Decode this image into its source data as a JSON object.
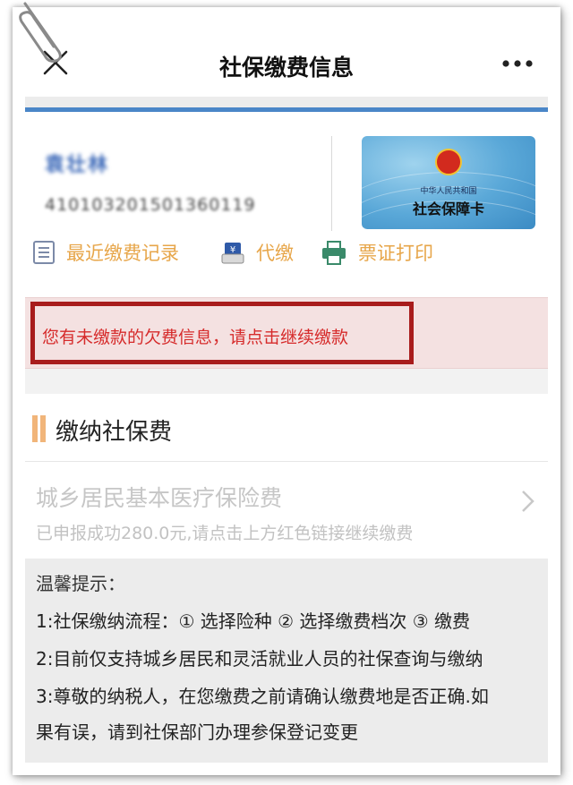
{
  "header": {
    "title": "社保缴费信息",
    "close_icon": "close-icon",
    "more_icon": "more-icon"
  },
  "user": {
    "name": "袁壮林",
    "id_number": "410103201501360119"
  },
  "social_card": {
    "issuer": "中华人民共和国",
    "title": "社会保障卡"
  },
  "actions": [
    {
      "label": "最近缴费记录",
      "icon": "list-icon"
    },
    {
      "label": "代缴",
      "icon": "bank-card-icon"
    },
    {
      "label": "票证打印",
      "icon": "printer-icon"
    }
  ],
  "alert": {
    "text": "您有未缴款的欠费信息，请点击继续缴款"
  },
  "section": {
    "title": "缴纳社保费"
  },
  "item": {
    "title": "城乡居民基本医疗保险费",
    "subtitle": "已申报成功280.0元,请点击上方红色链接继续缴费"
  },
  "tips": {
    "heading": "温馨提示：",
    "lines": [
      "1:社保缴纳流程：① 选择险种 ② 选择缴费档次 ③ 缴费",
      "2:目前仅支持城乡居民和灵活就业人员的社保查询与缴纳",
      "3:尊敬的纳税人，在您缴费之前请确认缴费地是否正确.如",
      "果有误，请到社保部门办理参保登记变更"
    ]
  },
  "colors": {
    "accent_blue": "#4a86c8",
    "action_orange": "#e7a64a",
    "alert_red": "#d62b2b",
    "alert_border": "#a81c1c"
  }
}
